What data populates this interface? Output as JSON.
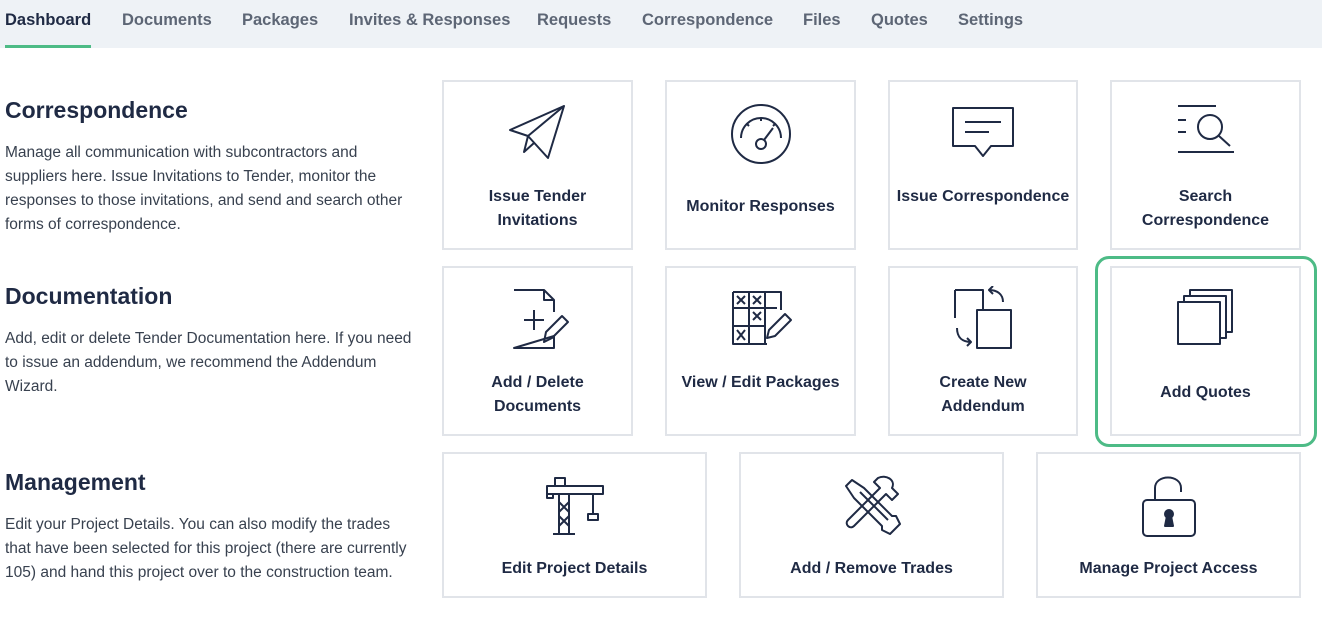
{
  "tabs": [
    "Dashboard",
    "Documents",
    "Packages",
    "Invites & Responses",
    "Requests",
    "Correspondence",
    "Files",
    "Quotes",
    "Settings"
  ],
  "sections": {
    "correspondence": {
      "title": "Correspondence",
      "description": "Manage all communication with subcontractors and suppliers here. Issue Invitations to Tender, monitor the responses to those invitations, and send and search other forms of correspondence."
    },
    "documentation": {
      "title": "Documentation",
      "description": "Add, edit or delete Tender Documentation here. If you need to issue an addendum, we recommend the Addendum Wizard."
    },
    "management": {
      "title": "Management",
      "description": "Edit your Project Details. You can also modify the trades that have been selected for this project (there are currently 105) and hand this project over to the construction team."
    }
  },
  "cards": {
    "issue_tender_invitations": {
      "label": "Issue Tender Invitations",
      "icon": "paper-plane-icon"
    },
    "monitor_responses": {
      "label": "Monitor Responses",
      "icon": "gauge-icon"
    },
    "issue_correspondence": {
      "label": "Issue Correspondence",
      "icon": "message-icon"
    },
    "search_correspondence": {
      "label": "Search Correspondence",
      "icon": "list-search-icon"
    },
    "add_delete_documents": {
      "label": "Add / Delete Documents",
      "icon": "document-edit-icon"
    },
    "view_edit_packages": {
      "label": "View / Edit Packages",
      "icon": "grid-edit-icon"
    },
    "create_new_addendum": {
      "label": "Create New Addendum",
      "icon": "copy-arrows-icon"
    },
    "add_quotes": {
      "label": "Add Quotes",
      "icon": "stacked-pages-icon"
    },
    "edit_project_details": {
      "label": "Edit Project Details",
      "icon": "crane-icon"
    },
    "add_remove_trades": {
      "label": "Add / Remove Trades",
      "icon": "tools-icon"
    },
    "manage_project_access": {
      "label": "Manage Project Access",
      "icon": "padlock-icon"
    }
  },
  "colors": {
    "accent": "#4dbb86",
    "text": "#1f2a44",
    "tabbar_bg": "#eef2f6",
    "card_border": "#e1e4e9"
  }
}
